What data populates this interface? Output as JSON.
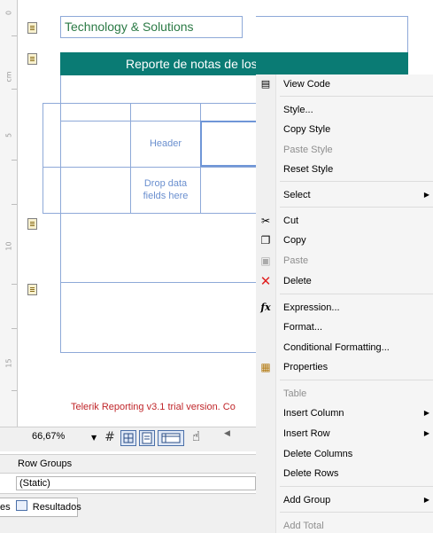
{
  "ruler": {
    "labels": [
      "0",
      "cm",
      "5",
      "10",
      "15"
    ]
  },
  "report": {
    "company": "Technology & Solutions",
    "title": "Reporte de notas de los proveedores",
    "table": {
      "header_cell": "Header",
      "data_placeholder": "Drop data fields here"
    },
    "trial_notice": "Telerik Reporting v3.1 trial version. Co"
  },
  "toolbar": {
    "zoom": "66,67%"
  },
  "groups": {
    "row_groups_title": "Row Groups",
    "static_item": "(Static)"
  },
  "bottom_tabs": {
    "partial_prefix": "es",
    "results_tab": "Resultados"
  },
  "context_menu": {
    "items": [
      {
        "label": "View Code",
        "enabled": true,
        "icon": "view-code-icon"
      },
      {
        "label": "Style...",
        "enabled": true
      },
      {
        "label": "Copy Style",
        "enabled": true
      },
      {
        "label": "Paste Style",
        "enabled": false
      },
      {
        "label": "Reset Style",
        "enabled": true
      },
      {
        "label": "Select",
        "enabled": true,
        "submenu": true
      },
      {
        "label": "Cut",
        "enabled": true,
        "icon": "scissors-icon"
      },
      {
        "label": "Copy",
        "enabled": true,
        "icon": "copy-icon"
      },
      {
        "label": "Paste",
        "enabled": false,
        "icon": "paste-icon"
      },
      {
        "label": "Delete",
        "enabled": true,
        "icon": "delete-icon"
      },
      {
        "label": "Expression...",
        "enabled": true,
        "icon": "fx-icon"
      },
      {
        "label": "Format...",
        "enabled": true
      },
      {
        "label": "Conditional Formatting...",
        "enabled": true
      },
      {
        "label": "Properties",
        "enabled": true,
        "icon": "properties-icon"
      },
      {
        "label": "Table",
        "enabled": false
      },
      {
        "label": "Insert Column",
        "enabled": true,
        "submenu": true
      },
      {
        "label": "Insert Row",
        "enabled": true,
        "submenu": true
      },
      {
        "label": "Delete Columns",
        "enabled": true
      },
      {
        "label": "Delete Rows",
        "enabled": true
      },
      {
        "label": "Add Group",
        "enabled": true,
        "submenu": true
      },
      {
        "label": "Add Total",
        "enabled": false
      }
    ]
  }
}
